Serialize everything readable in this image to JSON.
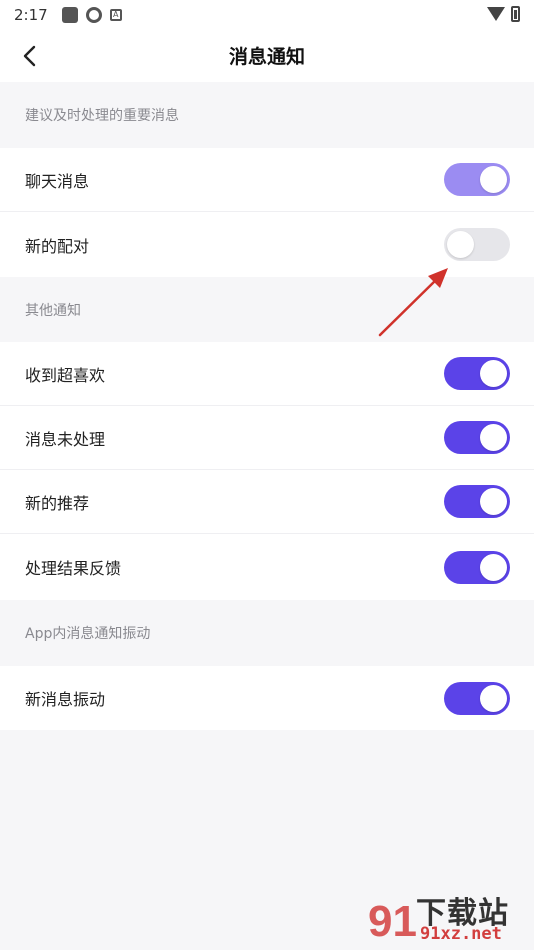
{
  "status_bar": {
    "time": "2:17",
    "icons": [
      "square-icon",
      "sync-icon",
      "a-icon"
    ],
    "right_icons": [
      "wifi-icon",
      "battery-icon"
    ]
  },
  "header": {
    "back_icon": "back-arrow-icon",
    "title": "消息通知"
  },
  "sections": [
    {
      "title": "建议及时处理的重要消息",
      "items": [
        {
          "label": "聊天消息",
          "enabled": true
        },
        {
          "label": "新的配对",
          "enabled": false
        }
      ]
    },
    {
      "title": "其他通知",
      "items": [
        {
          "label": "收到超喜欢",
          "enabled": true
        },
        {
          "label": "消息未处理",
          "enabled": true
        },
        {
          "label": "新的推荐",
          "enabled": true
        },
        {
          "label": "处理结果反馈",
          "enabled": true
        }
      ]
    },
    {
      "title": "App内消息通知振动",
      "items": [
        {
          "label": "新消息振动",
          "enabled": true
        }
      ]
    }
  ],
  "colors": {
    "toggle_on": "#5b43e8",
    "toggle_on_light": "#9b8cf2",
    "toggle_off": "#e6e6ea",
    "arrow": "#d0322b",
    "watermark_red": "#d23e3e"
  },
  "watermark": {
    "title": "下载站",
    "sub": "91xz.net"
  }
}
